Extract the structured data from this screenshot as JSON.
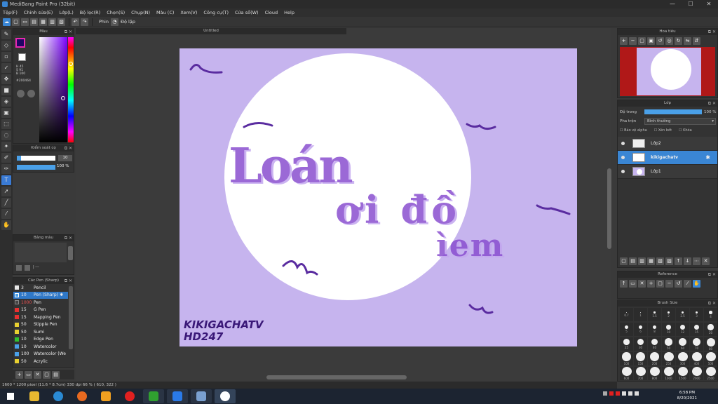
{
  "window": {
    "title": "MediBang Paint Pro (32bit)",
    "controls": [
      "—",
      "☐",
      "✕"
    ]
  },
  "menu": [
    "Tệp(F)",
    "Chỉnh sửa(E)",
    "Lớp(L)",
    "Bộ lọc(R)",
    "Chọn(S)",
    "Chụp(N)",
    "Màu (C)",
    "Xem(V)",
    "Công cụ(T)",
    "Cửa sổ(W)",
    "Cloud",
    "Help"
  ],
  "toolbar": {
    "pen_label": "Phin",
    "stabilizer_label": "Độ lặp"
  },
  "color_panel": {
    "title": "Màu",
    "values": "H 45\nS 91\nB 100",
    "hex": "#200464"
  },
  "brush_size_panel": {
    "title": "Kiểm soát cọ",
    "size": "10",
    "opacity": "100 %"
  },
  "palette_panel": {
    "title": "Bảng màu",
    "bottom": "| ---"
  },
  "brush_list": {
    "title": "Các Pen (Sharp)",
    "items": [
      {
        "size": "3",
        "name": "Pencil",
        "color": "#e8e8e8"
      },
      {
        "size": "10",
        "name": "Pen (Sharp)",
        "color": "#4aa0e8"
      },
      {
        "size": "1000",
        "name": "Pen",
        "color": "#444444"
      },
      {
        "size": "15",
        "name": "G Pen",
        "color": "#e83030"
      },
      {
        "size": "15",
        "name": "Mapping Pen",
        "color": "#e83030"
      },
      {
        "size": "50",
        "name": "Stipple Pen",
        "color": "#e8d030"
      },
      {
        "size": "50",
        "name": "Sumi",
        "color": "#e8d030"
      },
      {
        "size": "10",
        "name": "Edge Pen",
        "color": "#30c030"
      },
      {
        "size": "10",
        "name": "Watercolor",
        "color": "#4aa0e8"
      },
      {
        "size": "100",
        "name": "Watercolor (We",
        "color": "#4aa0e8"
      },
      {
        "size": "50",
        "name": "Acrylic",
        "color": "#e8d030"
      }
    ]
  },
  "document": {
    "tab_title": "Untitled"
  },
  "artwork": {
    "line1": "Loán",
    "line2": "ơi đồ",
    "line3": "ìem",
    "signature1": "KIKIGACHATV",
    "signature2": "HD247",
    "bg_color": "#c6b4ee",
    "accent_color": "#7a3fc4"
  },
  "statusbar": {
    "text": "1600 * 1200 pixel  (11.6 * 8.7cm)  330 dpi  66 %  ( 610, 322 )"
  },
  "navigator": {
    "title": "Hoa tiêu"
  },
  "layers": {
    "title": "Lớp",
    "opacity_label": "Độ trong",
    "opacity_value": "100 %",
    "blend_label": "Pha trộn",
    "blend_value": "Bình thường",
    "protect_alpha": "Bảo vệ alpha",
    "clipping": "Xén bớt",
    "lock": "Khóa",
    "items": [
      {
        "name": "Lớp2",
        "selected": false
      },
      {
        "name": "kikigachatv",
        "selected": true
      },
      {
        "name": "Lớp1",
        "selected": false
      }
    ]
  },
  "reference": {
    "title": "Reference"
  },
  "brush_sizes": {
    "title": "Brush Size",
    "sizes": [
      "0.7",
      "1",
      "1.5",
      "2",
      "2.5",
      "3",
      "4",
      "5",
      "6",
      "8",
      "10",
      "12",
      "15",
      "20",
      "25",
      "30",
      "40",
      "50",
      "60",
      "70",
      "80",
      "100",
      "150",
      "200",
      "250",
      "300",
      "400",
      "500",
      "600",
      "700",
      "800",
      "1000",
      "1500",
      "2000",
      "2500"
    ]
  },
  "clock": {
    "time": "6:58 PM",
    "date": "8/20/2021"
  }
}
